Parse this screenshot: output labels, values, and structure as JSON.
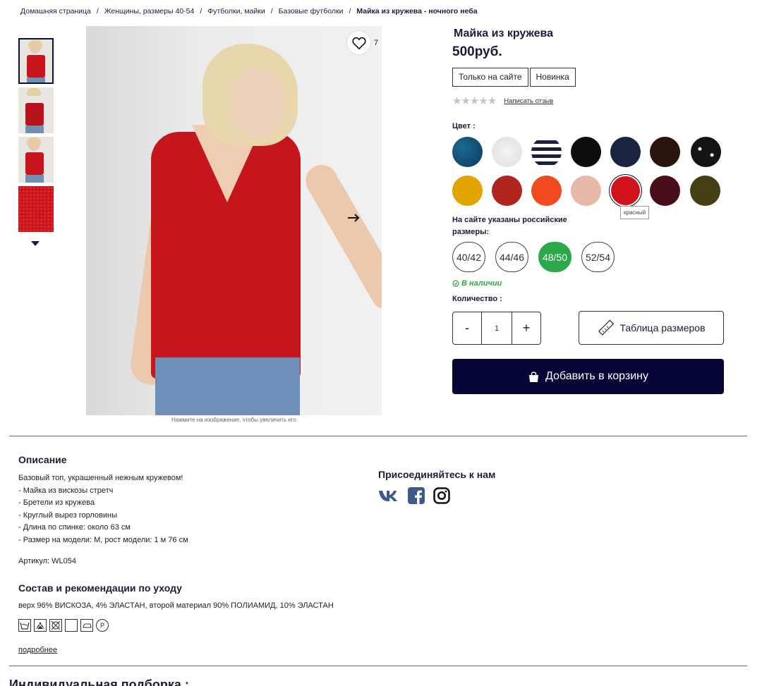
{
  "breadcrumb": {
    "items": [
      "Домашняя страница",
      "Женщины, размеры 40-54",
      "Футболки, майки",
      "Базовые футболки"
    ],
    "current": "Майка из кружева - ночного неба",
    "separator": "/"
  },
  "gallery": {
    "favorites_count": "7",
    "zoom_hint": "Нажмите на изображение, чтобы увеличить его"
  },
  "product": {
    "title": "Майка из кружева",
    "price": "500руб.",
    "tags": [
      "Только на сайте",
      "Новинка"
    ],
    "stars": "★★★★★",
    "review_link": "Написать отзыв",
    "color_label": "Цвет :",
    "colors": [
      {
        "name": "petrol",
        "hex": "#0f4a6e"
      },
      {
        "name": "white",
        "hex": "#e9e9e9"
      },
      {
        "name": "stripes",
        "hex": "#1b1f3b"
      },
      {
        "name": "black",
        "hex": "#0d0d0d"
      },
      {
        "name": "navy",
        "hex": "#1a2340"
      },
      {
        "name": "brown",
        "hex": "#2b140f"
      },
      {
        "name": "black-print",
        "hex": "#141414"
      },
      {
        "name": "mustard",
        "hex": "#e3a300"
      },
      {
        "name": "rust",
        "hex": "#b0261d"
      },
      {
        "name": "orange",
        "hex": "#f24a1f"
      },
      {
        "name": "nude",
        "hex": "#e8b8a8"
      },
      {
        "name": "red",
        "hex": "#d2121a"
      },
      {
        "name": "burgundy",
        "hex": "#4a0d1a"
      },
      {
        "name": "khaki",
        "hex": "#463f14"
      }
    ],
    "color_tooltip": "красный",
    "size_note": "На сайте указаны российские размеры:",
    "sizes": [
      "40/42",
      "44/46",
      "48/50",
      "52/54"
    ],
    "selected_size": "48/50",
    "stock": "В наличии",
    "qty_label": "Количество :",
    "qty_minus": "-",
    "qty_value": "1",
    "qty_plus": "+",
    "size_table": "Таблица размеров",
    "add_to_cart": "Добавить в корзину"
  },
  "description": {
    "title": "Описание",
    "lines": [
      "Базовый топ, украшенный нежным кружевом!",
      "- Майка из вискозы стретч",
      "- Бретели из кружева",
      "- Круглый вырез горловины",
      "- Длина по спинке: около 63 см",
      "- Размер на модели: M, рост модели: 1 м 76 см"
    ],
    "article": "Артикул: WL054"
  },
  "composition": {
    "title": "Состав и рекомендации по уходу",
    "text": "верх 96% ВИСКОЗА, 4% ЭЛАСТАН, второй материал 90% ПОЛИАМИД, 10% ЭЛАСТАН",
    "care_icons": [
      "wash-30-icon",
      "no-bleach-icon",
      "no-tumble-dry-icon",
      "dry-flat-icon",
      "iron-low-icon",
      "dry-clean-p-icon"
    ],
    "more_link": "подробнее"
  },
  "social": {
    "title": "Присоединяйтесь к нам",
    "icons": [
      "vk-icon",
      "facebook-icon",
      "instagram-icon"
    ]
  },
  "next_section": {
    "title": "Индивидуальная подборка :"
  },
  "colors": {
    "primary": "#050536",
    "text": "#1b1b3a",
    "success": "#2aa84a"
  }
}
